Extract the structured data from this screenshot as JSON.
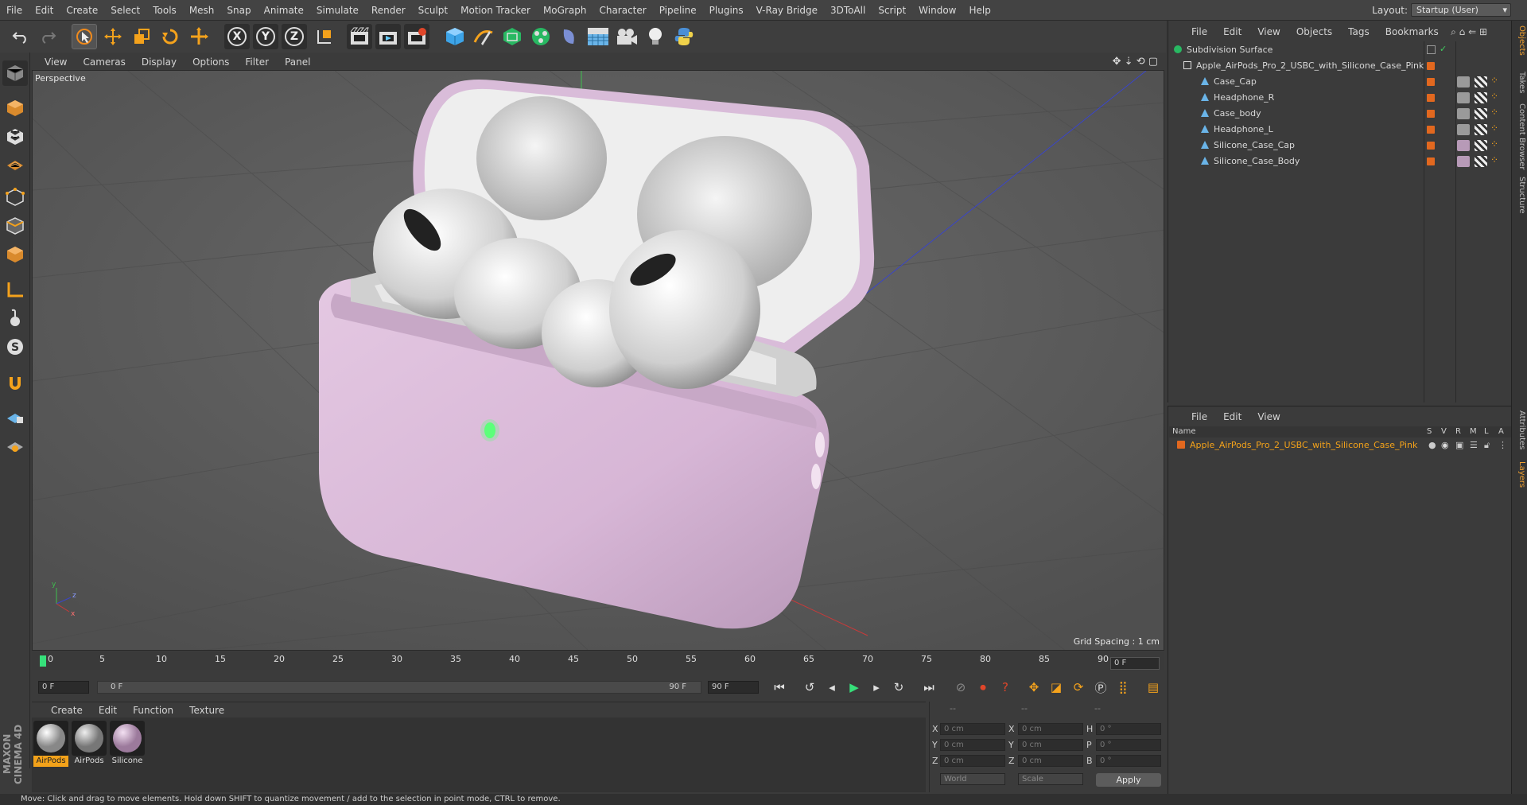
{
  "menubar": {
    "items": [
      "File",
      "Edit",
      "Create",
      "Select",
      "Tools",
      "Mesh",
      "Snap",
      "Animate",
      "Simulate",
      "Render",
      "Sculpt",
      "Motion Tracker",
      "MoGraph",
      "Character",
      "Pipeline",
      "Plugins",
      "V-Ray Bridge",
      "3DToAll",
      "Script",
      "Window",
      "Help"
    ],
    "layout_label": "Layout:",
    "layout_value": "Startup (User)"
  },
  "toolbar": {
    "axis_x": "X",
    "axis_y": "Y",
    "axis_z": "Z"
  },
  "viewport": {
    "menu": [
      "View",
      "Cameras",
      "Display",
      "Options",
      "Filter",
      "Panel"
    ],
    "camera_label": "Perspective",
    "grid_spacing": "Grid Spacing : 1 cm"
  },
  "timeline": {
    "ticks": [
      "0",
      "5",
      "10",
      "15",
      "20",
      "25",
      "30",
      "35",
      "40",
      "45",
      "50",
      "55",
      "60",
      "65",
      "70",
      "75",
      "80",
      "85",
      "90"
    ],
    "current_frame": "0 F",
    "start_field": "0 F",
    "range_start": "0 F",
    "range_end": "90 F",
    "end_field": "90 F"
  },
  "materials": {
    "menu": [
      "Create",
      "Edit",
      "Function",
      "Texture"
    ],
    "items": [
      {
        "label": "AirPods",
        "selected": true,
        "color": "#dcdcdc"
      },
      {
        "label": "AirPods",
        "selected": false,
        "color": "#c8c8c8"
      },
      {
        "label": "Silicone",
        "selected": false,
        "color": "#c9a8c9"
      }
    ]
  },
  "coords": {
    "header_pos": "--",
    "header_size": "--",
    "header_rot": "--",
    "x_label": "X",
    "y_label": "Y",
    "z_label": "Z",
    "h_label": "H",
    "p_label": "P",
    "b_label": "B",
    "pos_x": "0 cm",
    "pos_y": "0 cm",
    "pos_z": "0 cm",
    "size_x": "0 cm",
    "size_y": "0 cm",
    "size_z": "0 cm",
    "rot_h": "0 °",
    "rot_p": "0 °",
    "rot_b": "0 °",
    "mode_world": "World",
    "mode_scale": "Scale",
    "apply": "Apply"
  },
  "status": {
    "text": "Move: Click and drag to move elements. Hold down SHIFT to quantize movement / add to the selection in point mode, CTRL to remove."
  },
  "object_manager": {
    "menu": [
      "File",
      "Edit",
      "View",
      "Objects",
      "Tags",
      "Bookmarks"
    ],
    "root": "Subdivision Surface",
    "group": "Apple_AirPods_Pro_2_USBC_with_Silicone_Case_Pink",
    "children": [
      "Case_Cap",
      "Headphone_R",
      "Case_body",
      "Headphone_L",
      "Silicone_Case_Cap",
      "Silicone_Case_Body"
    ]
  },
  "layer_manager": {
    "menu": [
      "File",
      "Edit",
      "View"
    ],
    "col_name": "Name",
    "cols": [
      "S",
      "V",
      "R",
      "M",
      "L",
      "A"
    ],
    "layer": "Apple_AirPods_Pro_2_USBC_with_Silicone_Case_Pink"
  },
  "right_tabs": [
    "Objects",
    "Takes",
    "Content Browser",
    "Structure",
    "Attributes",
    "Layers"
  ],
  "brand": "MAXON CINEMA 4D",
  "colors": {
    "accent": "#f3a21a",
    "case_pink": "#d9bcd9",
    "led_green": "#5cff7a"
  }
}
